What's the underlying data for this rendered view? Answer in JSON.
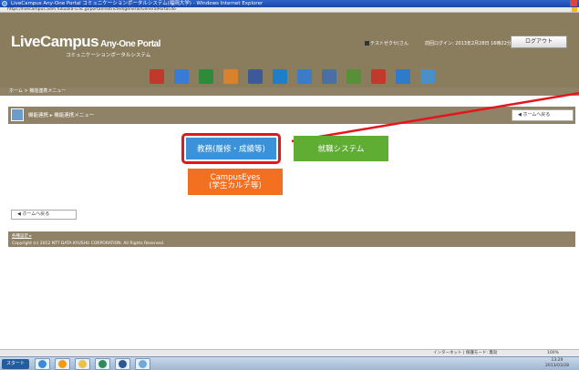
{
  "browser": {
    "title": "LiveCampus Any-One Portal コミュニケーションポータルシステム(福岡大学) - Windows Internet Explorer",
    "url": "https://livecampus.adm.fukuoka-u.ac.jp/portal/restricted/general/GeneralPortal.do"
  },
  "header": {
    "logo": "LiveCampus",
    "logo_suffix": "Any-One Portal",
    "subtitle": "コミュニケーションポータルシステム",
    "user": "テストゼクセ(さん",
    "last_login": "前回ログイン: 2013年2月28日 16時22分",
    "logout": "ログアウト",
    "nav": [
      {
        "label": "ホーム",
        "color": "#c0392b"
      },
      {
        "label": "スケジュール",
        "color": "#3a7bd5"
      },
      {
        "label": "掲示",
        "color": "#2e8b3a"
      },
      {
        "label": "連絡通知",
        "color": "#d9822b"
      },
      {
        "label": "機能連携",
        "color": "#3c5a99"
      },
      {
        "label": "リンク",
        "color": "#1f7ec7"
      },
      {
        "label": "アンケート",
        "color": "#3b7dc4"
      },
      {
        "label": "レポート",
        "color": "#4a6fa5"
      },
      {
        "label": "Q&A",
        "color": "#5a8f3a"
      },
      {
        "label": "掲載ホーム",
        "color": "#c0392b"
      },
      {
        "label": "ダウンロード",
        "color": "#2e7bc9"
      },
      {
        "label": "クラスマイス",
        "color": "#4a8fc8"
      }
    ]
  },
  "breadcrumb": "ホーム > 機能連携メニュー",
  "panel": {
    "title": "機能連携 ▸ 機能連携メニュー",
    "home_button_top": "ホームへ戻る"
  },
  "tiles": {
    "academic": "教務(履修・成績等)",
    "job": "就職システム",
    "campus_eyes_line1": "CampusEyes",
    "campus_eyes_line2": "(学生カルテ等)"
  },
  "home_button_bottom": "ホームへ戻る",
  "footer": {
    "support": "各種設定 ▸",
    "copyright": "Copyright (c) 2012 NTT DATA KYUSHU CORPORATION. All Rights Reserved."
  },
  "statusbar": {
    "zone": "インターネット | 保護モード: 無効",
    "zoom": "100%"
  },
  "taskbar": {
    "start": "スタート",
    "clock_time": "13:29",
    "clock_date": "2013/03/28"
  },
  "colors": {
    "header_bg": "#8a7d5e",
    "tile_blue": "#3b92d8",
    "tile_green": "#60ad34",
    "tile_orange": "#f37021",
    "highlight_red": "#e4161c"
  }
}
